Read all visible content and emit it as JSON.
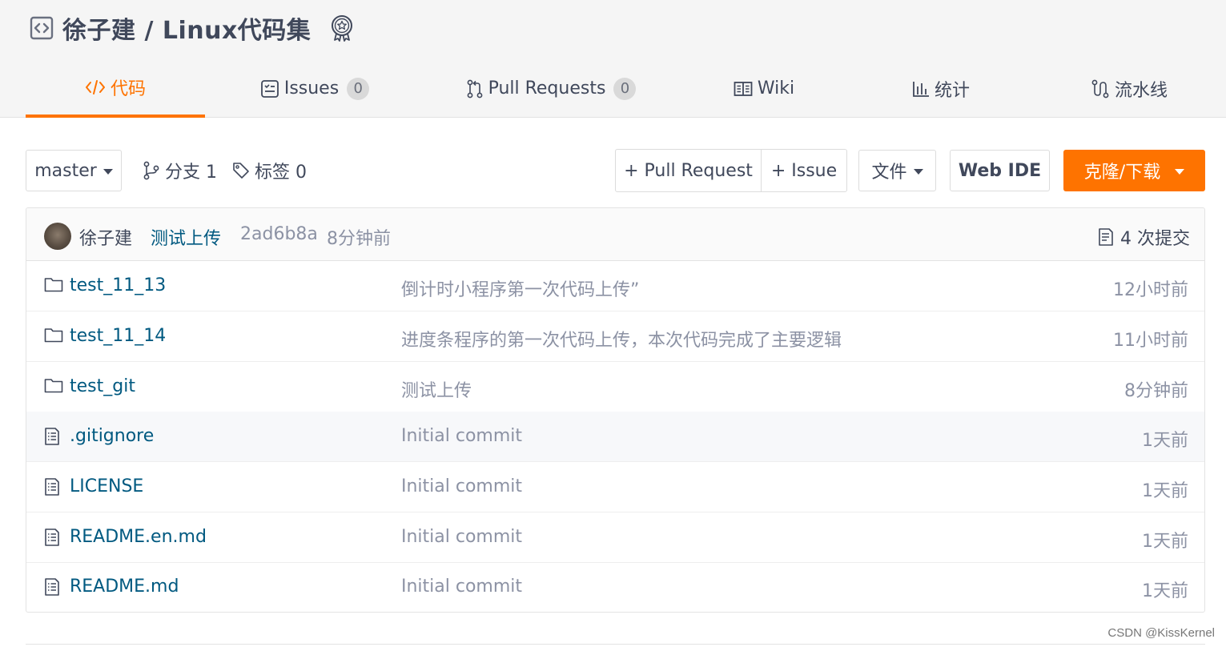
{
  "repo": {
    "title": "徐子建 / Linux代码集"
  },
  "tabs": [
    {
      "label": "代码",
      "icon": "code-icon",
      "active": true
    },
    {
      "label": "Issues",
      "count": "0",
      "icon": "issues-icon"
    },
    {
      "label": "Pull Requests",
      "count": "0",
      "icon": "pull-request-icon"
    },
    {
      "label": "Wiki",
      "icon": "wiki-book-icon"
    },
    {
      "label": "统计",
      "icon": "stats-bar-icon"
    },
    {
      "label": "流水线",
      "icon": "pipeline-icon"
    }
  ],
  "toolbar": {
    "branch": "master",
    "branches_label": "分支 1",
    "tags_label": "标签 0",
    "pull_request_label": "+ Pull Request",
    "issue_label": "+ Issue",
    "file_label": "文件",
    "web_ide_label": "Web IDE",
    "clone_label": "克隆/下载"
  },
  "latest_commit": {
    "author": "徐子建",
    "message": "测试上传",
    "sha": "2ad6b8a",
    "time": "8分钟前",
    "commit_count": "4 次提交"
  },
  "files": [
    {
      "name": "test_11_13",
      "type": "folder",
      "message": "倒计时小程序第一次代码上传”",
      "time": "12小时前"
    },
    {
      "name": "test_11_14",
      "type": "folder",
      "message": "进度条程序的第一次代码上传，本次代码完成了主要逻辑",
      "time": "11小时前"
    },
    {
      "name": "test_git",
      "type": "folder",
      "message": "测试上传",
      "time": "8分钟前"
    },
    {
      "name": ".gitignore",
      "type": "file",
      "message": "Initial commit",
      "time": "1天前"
    },
    {
      "name": "LICENSE",
      "type": "file",
      "message": "Initial commit",
      "time": "1天前"
    },
    {
      "name": "README.en.md",
      "type": "file",
      "message": "Initial commit",
      "time": "1天前"
    },
    {
      "name": "README.md",
      "type": "file",
      "message": "Initial commit",
      "time": "1天前"
    }
  ],
  "watermark": "CSDN @KissKernel",
  "colors": {
    "accent": "#fe7300",
    "link": "#005980",
    "muted": "#8c92a4",
    "text": "#40485b"
  }
}
